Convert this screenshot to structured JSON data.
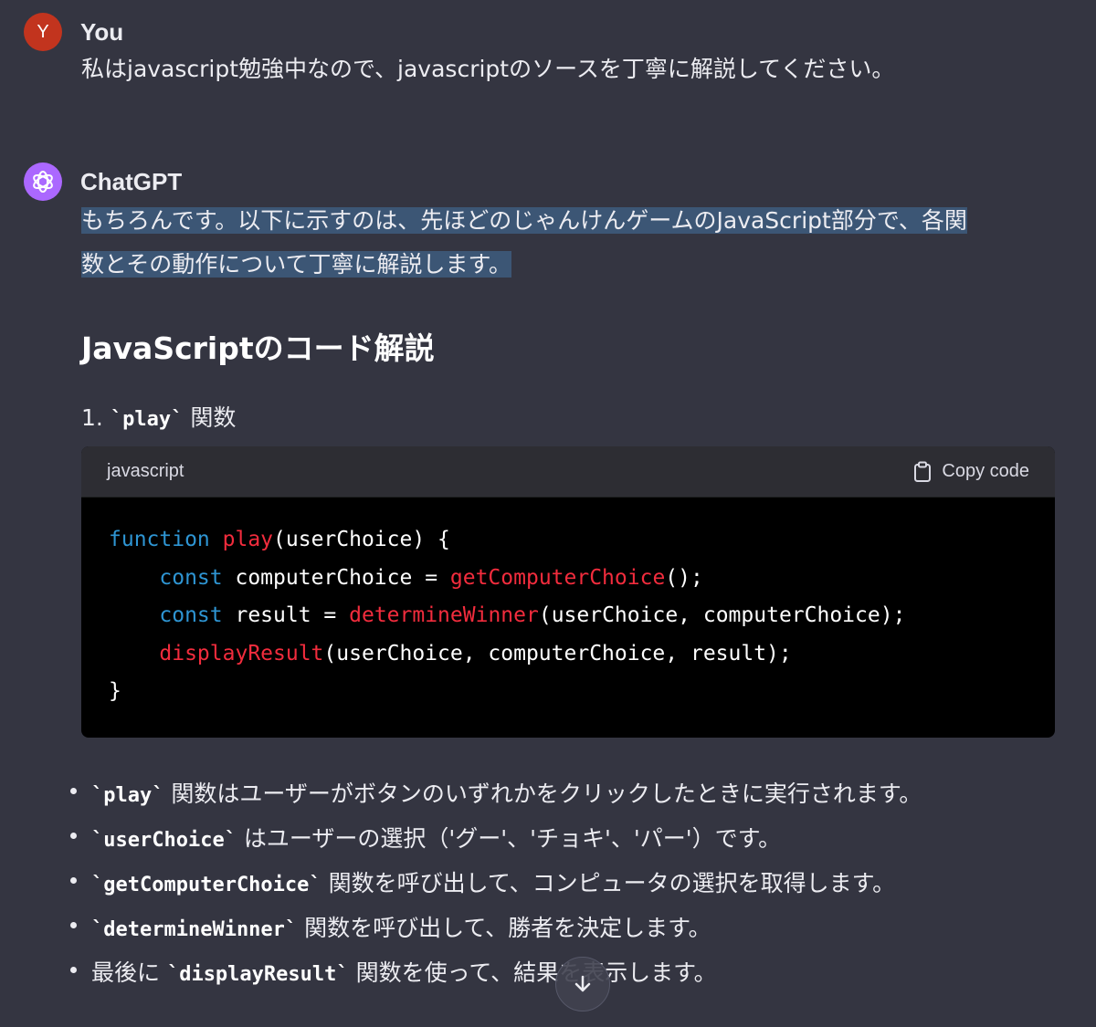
{
  "user_message": {
    "avatar_letter": "Y",
    "author": "You",
    "text": "私はjavascript勉強中なので、javascriptのソースを丁寧に解説してください。"
  },
  "assistant_message": {
    "author": "ChatGPT",
    "intro_line1": "もちろんです。以下に示すのは、先ほどのじゃんけんゲームのJavaScript部分で、各関",
    "intro_line2": "数とその動作について丁寧に解説します。",
    "heading": "JavaScriptのコード解説",
    "item": {
      "number": "1.",
      "code": "`play`",
      "suffix": "関数"
    },
    "code_block": {
      "language": "javascript",
      "copy_label": "Copy code",
      "lines": [
        [
          {
            "t": "function",
            "c": "kw"
          },
          {
            "t": " ",
            "c": ""
          },
          {
            "t": "play",
            "c": "fn"
          },
          {
            "t": "(userChoice) {",
            "c": ""
          }
        ],
        [
          {
            "t": "    ",
            "c": ""
          },
          {
            "t": "const",
            "c": "kw"
          },
          {
            "t": " computerChoice = ",
            "c": ""
          },
          {
            "t": "getComputerChoice",
            "c": "fn"
          },
          {
            "t": "();",
            "c": ""
          }
        ],
        [
          {
            "t": "    ",
            "c": ""
          },
          {
            "t": "const",
            "c": "kw"
          },
          {
            "t": " result = ",
            "c": ""
          },
          {
            "t": "determineWinner",
            "c": "fn"
          },
          {
            "t": "(userChoice, computerChoice);",
            "c": ""
          }
        ],
        [
          {
            "t": "    ",
            "c": ""
          },
          {
            "t": "displayResult",
            "c": "fn"
          },
          {
            "t": "(userChoice, computerChoice, result);",
            "c": ""
          }
        ],
        [
          {
            "t": "}",
            "c": ""
          }
        ]
      ]
    },
    "bullets": [
      {
        "pre": "",
        "code": "`play`",
        "post": " 関数はユーザーがボタンのいずれかをクリックしたときに実行されます。"
      },
      {
        "pre": "",
        "code": "`userChoice`",
        "post": " はユーザーの選択（'グー'、'チョキ'、'パー'）です。"
      },
      {
        "pre": "",
        "code": "`getComputerChoice`",
        "post": " 関数を呼び出して、コンピュータの選択を取得します。"
      },
      {
        "pre": "",
        "code": "`determineWinner`",
        "post": " 関数を呼び出して、勝者を決定します。"
      },
      {
        "pre": "最後に ",
        "code": "`displayResult`",
        "post": " 関数を使って、結果を表示します。"
      }
    ]
  },
  "icons": {
    "copy": "clipboard-icon",
    "scroll": "arrow-down-icon",
    "assistant_avatar": "openai-logo-icon"
  },
  "colors": {
    "background": "#343541",
    "highlight": "#3c5675",
    "keyword": "#2e95d3",
    "function": "#f22c3d",
    "user_avatar": "#c2341e",
    "assistant_avatar": "#ab68ff"
  }
}
